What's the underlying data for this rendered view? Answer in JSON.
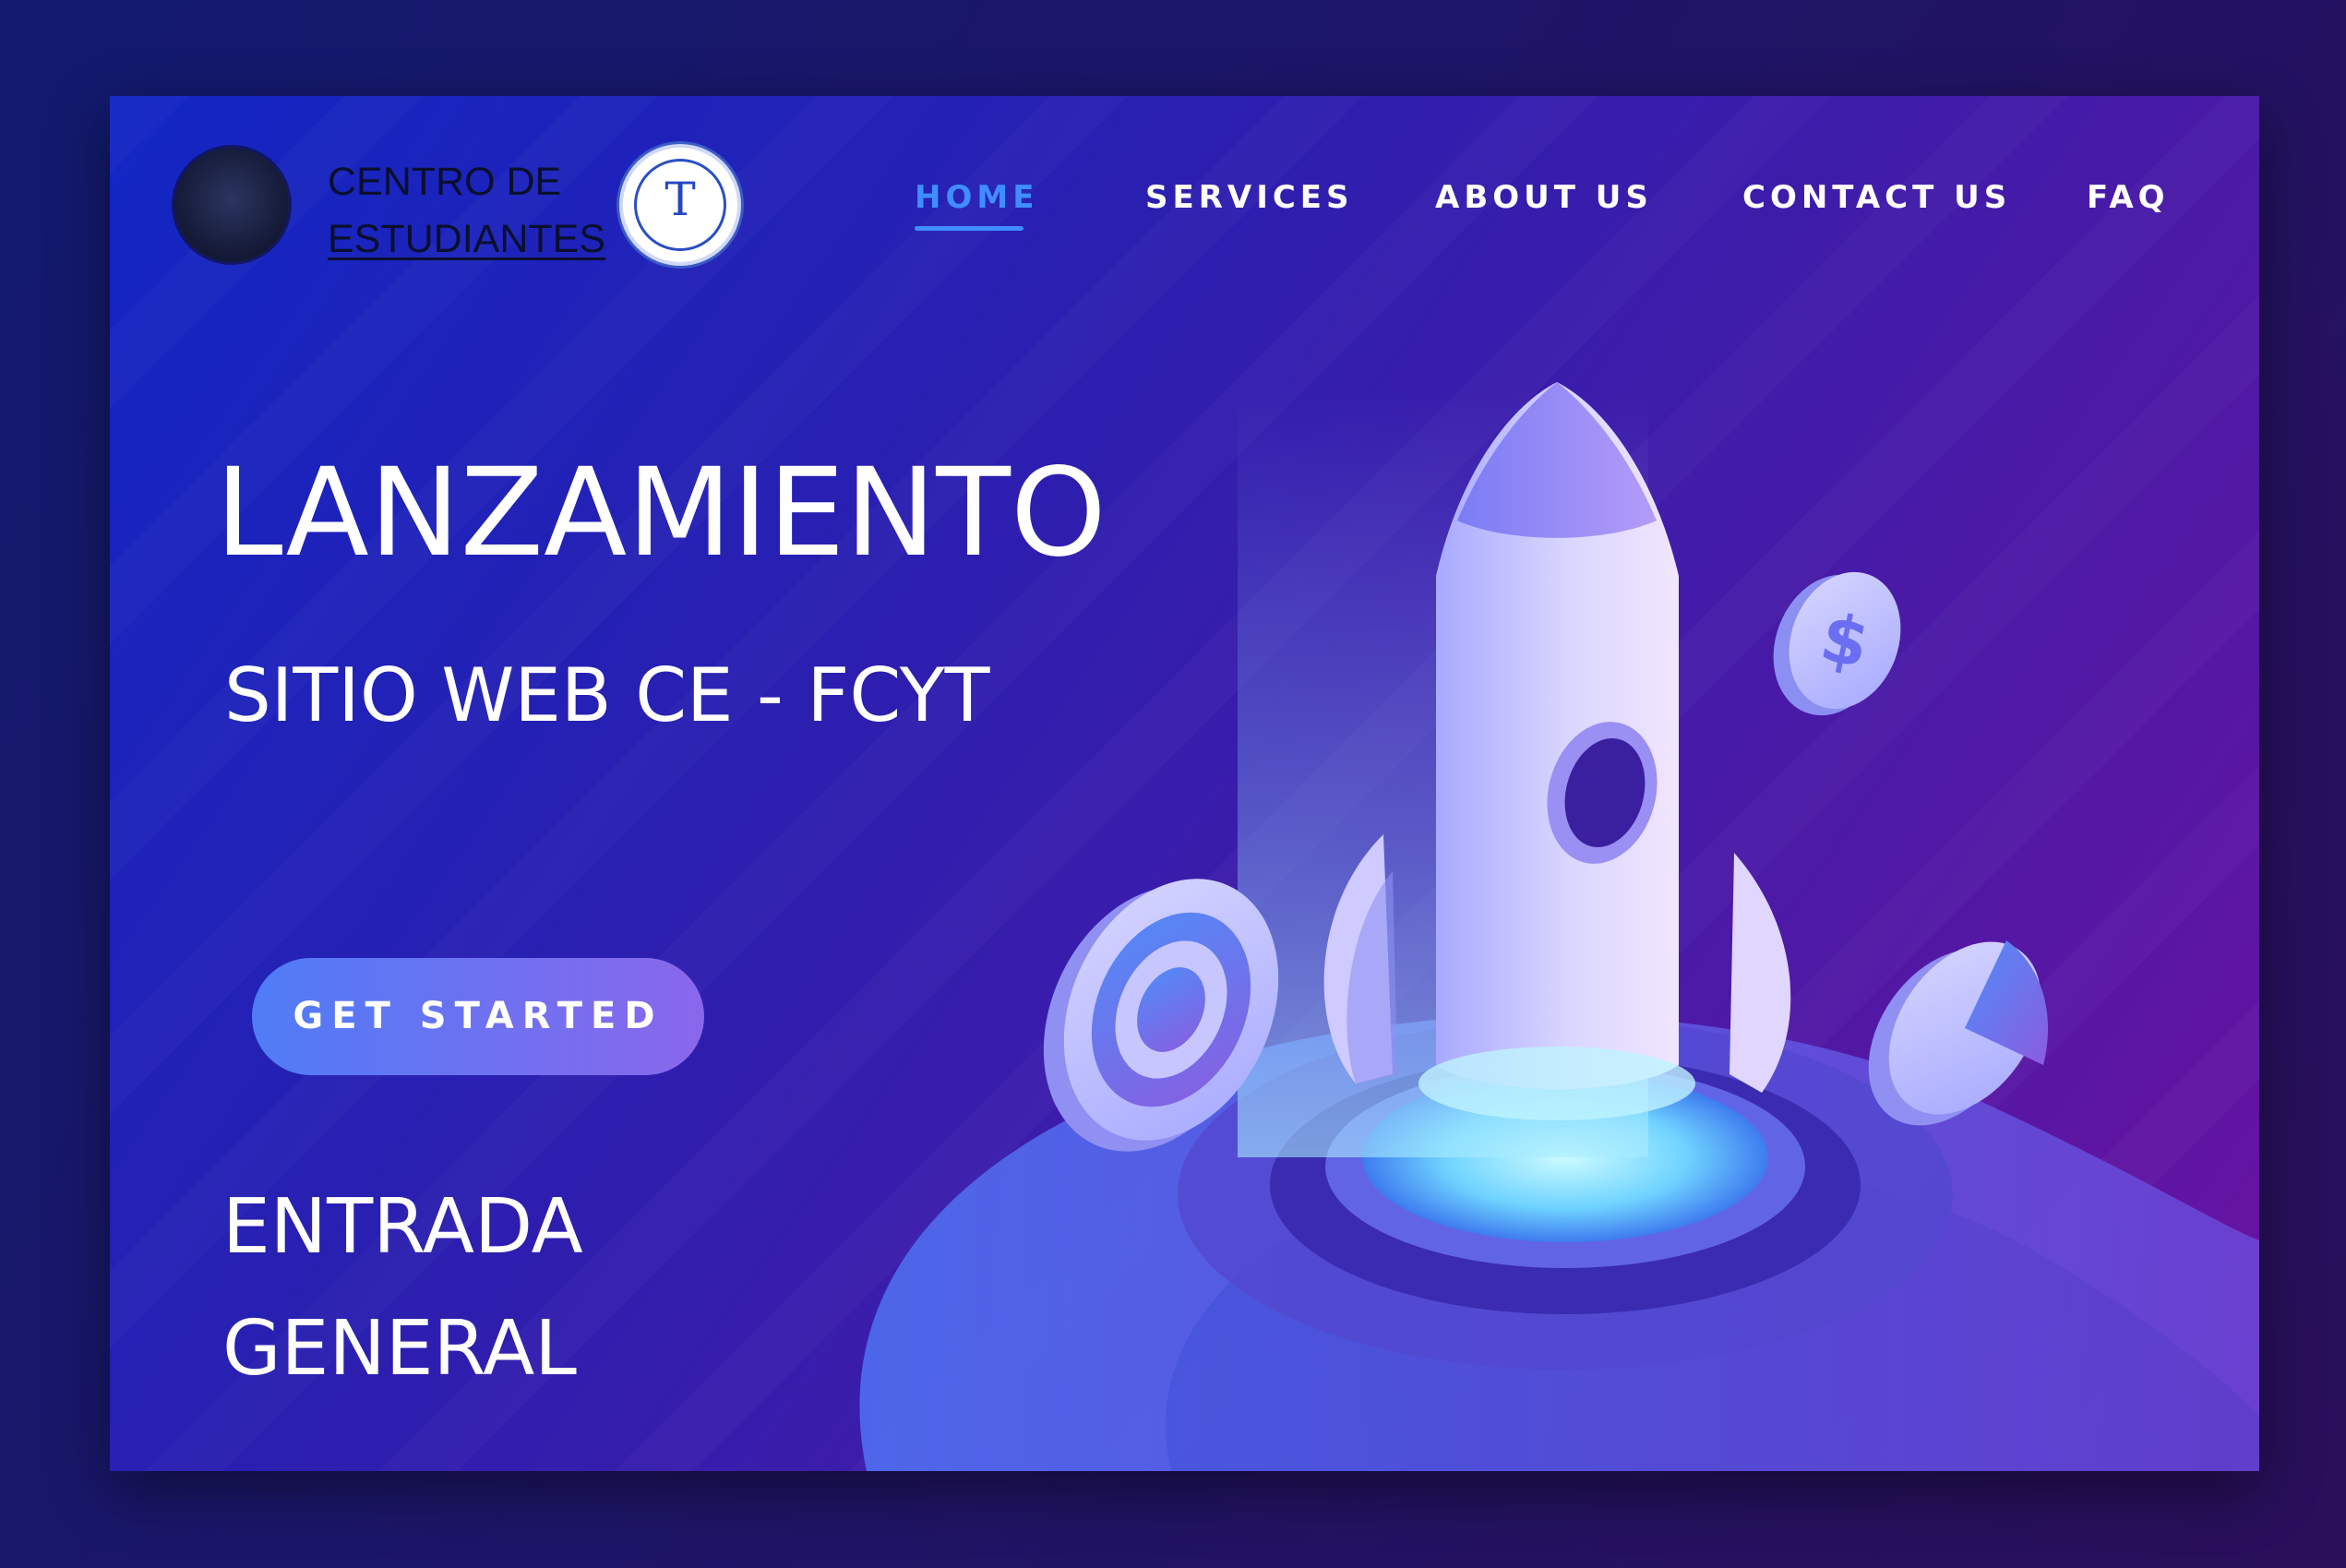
{
  "brand": {
    "name_line1": "CENTRO DE",
    "name_line2": "ESTUDIANTES",
    "seal_icon": "student-center-seal",
    "faculty_logo_letter": "T"
  },
  "nav": {
    "items": [
      {
        "label": "HOME",
        "active": true
      },
      {
        "label": "SERVICES",
        "active": false
      },
      {
        "label": "ABOUT US",
        "active": false
      },
      {
        "label": "CONTACT US",
        "active": false
      },
      {
        "label": "FAQ",
        "active": false
      }
    ]
  },
  "hero": {
    "title": "LANZAMIENTO",
    "subtitle": "SITIO WEB CE - FCYT",
    "cta_label": "GET STARTED",
    "entry_line1": "ENTRADA",
    "entry_line2": "GENERAL"
  },
  "illustration": {
    "icons": [
      "rocket-icon",
      "dollar-coin-icon",
      "target-icon",
      "pie-chart-icon"
    ],
    "coin_symbol": "$"
  },
  "colors": {
    "accent": "#3f8dff",
    "button_start": "#4f7cf6",
    "button_end": "#8a67ec",
    "card_start": "#1226c4",
    "card_end": "#6a12a0"
  }
}
